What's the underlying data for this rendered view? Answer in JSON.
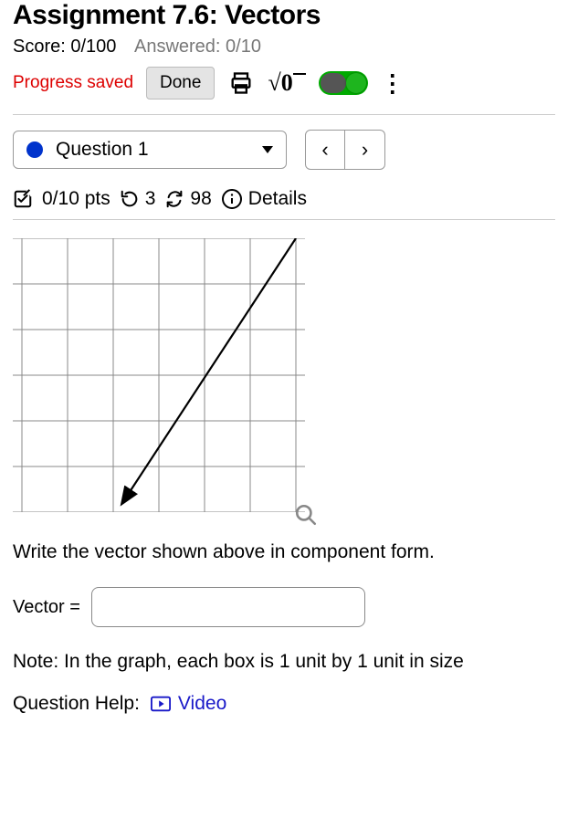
{
  "header": {
    "title": "Assignment 7.6: Vectors",
    "score_label": "Score: 0/100",
    "answered_label": "Answered: 0/10"
  },
  "toolbar": {
    "progress_saved": "Progress saved",
    "done_label": "Done",
    "sqrt_label": "√0"
  },
  "question_selector": {
    "current": "Question 1",
    "prev": "‹",
    "next": "›"
  },
  "pts_line": {
    "pts": "0/10 pts",
    "retries": "3",
    "reattempts": "98",
    "details": "Details"
  },
  "chart_data": {
    "type": "scatter",
    "title": "",
    "xlabel": "",
    "ylabel": "",
    "xlim": [
      0,
      6
    ],
    "ylim": [
      0,
      6
    ],
    "grid": true,
    "series": [
      {
        "name": "vector",
        "kind": "arrow",
        "from": [
          6,
          6
        ],
        "to": [
          2,
          0
        ]
      }
    ],
    "note": "each box is 1 unit by 1 unit"
  },
  "prompt": "Write the vector shown above in component form.",
  "answer": {
    "label": "Vector =",
    "value": ""
  },
  "note": "Note: In the graph, each box is 1 unit by 1 unit in size",
  "help": {
    "label": "Question Help:",
    "video": "Video"
  }
}
